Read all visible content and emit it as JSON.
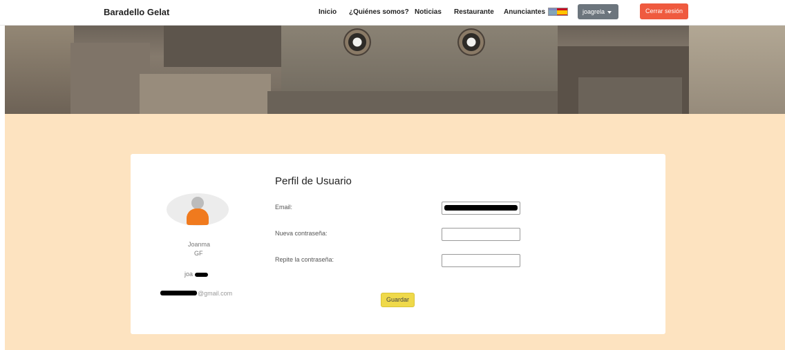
{
  "navbar": {
    "brand": "Baradello Gelat",
    "links": [
      "Inicio",
      "¿Quiénes somos?",
      "Noticias",
      "Restaurante",
      "Anunciantes"
    ],
    "language_flag": "spain-flag-icon",
    "user_dropdown": "joagrela",
    "logout": "Cerrar sesión",
    "colors": {
      "logout": "#ef5a3f",
      "user_dropdown": "#6c757d"
    }
  },
  "profile": {
    "first_name": "Joanma",
    "last_name": "GF",
    "username_visible": "joa",
    "email_visible": "@gmail.com"
  },
  "form": {
    "title": "Perfil de Usuario",
    "email_label": "Email:",
    "new_password_label": "Nueva contraseña:",
    "repeat_password_label": "Repite la contraseña:",
    "save": "Guardar"
  },
  "colors": {
    "page_background": "#fde3c0",
    "save_button": "#efd94a",
    "avatar_body": "#f07a1e"
  }
}
